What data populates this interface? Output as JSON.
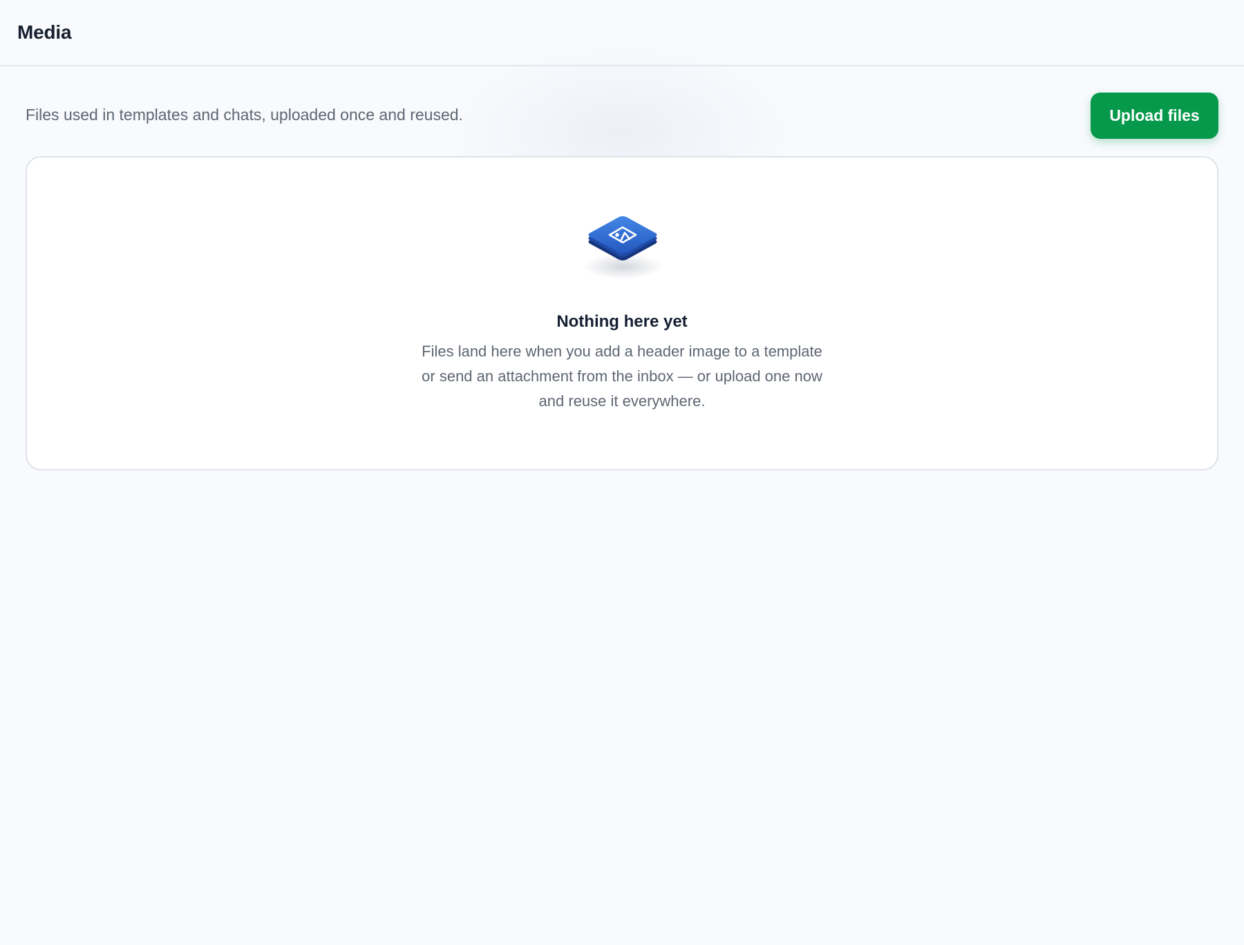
{
  "header": {
    "title": "Media"
  },
  "toolbar": {
    "subtitle": "Files used in templates and chats, uploaded once and reused.",
    "upload_label": "Upload files"
  },
  "empty_state": {
    "icon": "image-icon",
    "title": "Nothing here yet",
    "description": "Files land here when you add a header image to a template or send an attachment from the inbox — or upload one now and reuse it everywhere."
  },
  "colors": {
    "accent": "#06994b",
    "icon_blue": "#2f6fd1",
    "background": "#f8fafd"
  }
}
